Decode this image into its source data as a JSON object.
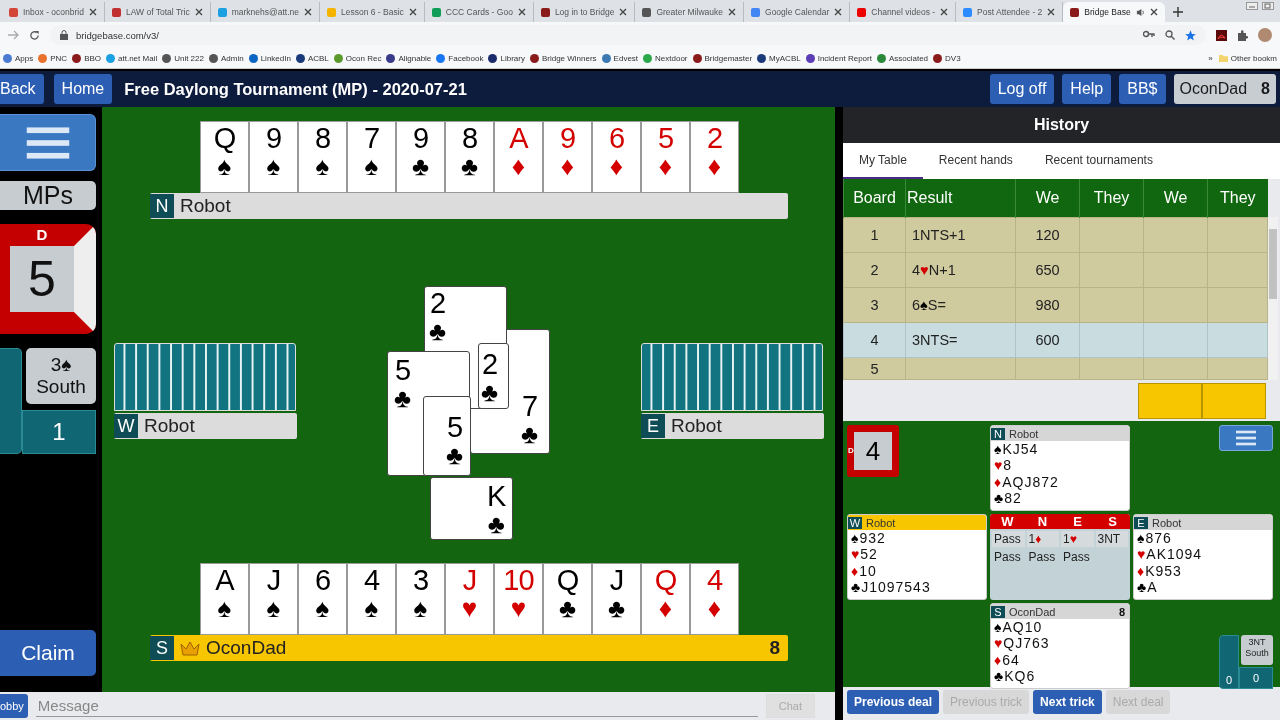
{
  "browser": {
    "tabs": [
      {
        "title": "Inbox - oconbrid",
        "color": "#d44638",
        "selected": false
      },
      {
        "title": "LAW of Total Tric",
        "color": "#c03030",
        "selected": false
      },
      {
        "title": "marknehs@att.ne",
        "color": "#1ba1e2",
        "selected": false
      },
      {
        "title": "Lesson 6 - Basic",
        "color": "#f4b400",
        "selected": false
      },
      {
        "title": "CCC Cards - Goo",
        "color": "#0f9d58",
        "selected": false
      },
      {
        "title": "Log in to Bridge",
        "color": "#8b1a1a",
        "selected": false
      },
      {
        "title": "Greater Milwauke",
        "color": "#555555",
        "selected": false
      },
      {
        "title": "Google Calendar",
        "color": "#4285f4",
        "selected": false
      },
      {
        "title": "Channel videos -",
        "color": "#ee0000",
        "selected": false
      },
      {
        "title": "Post Attendee - 2",
        "color": "#2d8cff",
        "selected": false
      },
      {
        "title": "Bridge Base",
        "color": "#8b1a1a",
        "selected": true
      }
    ],
    "url": "bridgebase.com/v3/",
    "bookmarks": [
      {
        "label": "Apps",
        "color": "#4a7bd0"
      },
      {
        "label": "PNC",
        "color": "#e8712b"
      },
      {
        "label": "BBO",
        "color": "#8b1a1a"
      },
      {
        "label": "att.net Mail",
        "color": "#1ba1e2"
      },
      {
        "label": "Unit 222",
        "color": "#555555"
      },
      {
        "label": "Admin",
        "color": "#555555"
      },
      {
        "label": "LinkedIn",
        "color": "#0a66c2"
      },
      {
        "label": "ACBL",
        "color": "#1a3a7a"
      },
      {
        "label": "Ocon Rec",
        "color": "#5a9a2a"
      },
      {
        "label": "Alignable",
        "color": "#3a3a8a"
      },
      {
        "label": "Facebook",
        "color": "#1877f2"
      },
      {
        "label": "Library",
        "color": "#1a2a6a"
      },
      {
        "label": "Bridge Winners",
        "color": "#8b1a1a"
      },
      {
        "label": "Edvest",
        "color": "#3a7ab0"
      },
      {
        "label": "Nextdoor",
        "color": "#2aa84a"
      },
      {
        "label": "Bridgemaster",
        "color": "#8b1a1a"
      },
      {
        "label": "MyACBL",
        "color": "#1a3a7a"
      },
      {
        "label": "Incident Report",
        "color": "#5b3db5"
      },
      {
        "label": "Associated",
        "color": "#2a8a3a"
      },
      {
        "label": "DV3",
        "color": "#8b1a1a"
      }
    ],
    "more": "»",
    "other": "Other bookm"
  },
  "app": {
    "nav": [
      "Back",
      "Home"
    ],
    "title": "Free Daylong Tournament (MP) - 2020-07-21",
    "actions": [
      "Log off",
      "Help",
      "BB$"
    ],
    "user": {
      "name": "OconDad",
      "badge": "8"
    }
  },
  "side": {
    "scoring": "MPs",
    "board": {
      "dealer": "D",
      "number": "5"
    },
    "contract": {
      "bid": "3",
      "suit": "♠",
      "declarer": "South"
    },
    "tricks": "1",
    "claim": "Claim"
  },
  "table": {
    "north": {
      "seat": "N",
      "name": "Robot",
      "active": false,
      "cards": [
        {
          "rank": "Q",
          "suit": "♠",
          "red": false
        },
        {
          "rank": "9",
          "suit": "♠",
          "red": false
        },
        {
          "rank": "8",
          "suit": "♠",
          "red": false
        },
        {
          "rank": "7",
          "suit": "♠",
          "red": false
        },
        {
          "rank": "9",
          "suit": "♣",
          "red": false
        },
        {
          "rank": "8",
          "suit": "♣",
          "red": false
        },
        {
          "rank": "A",
          "suit": "♦",
          "red": true
        },
        {
          "rank": "9",
          "suit": "♦",
          "red": true
        },
        {
          "rank": "6",
          "suit": "♦",
          "red": true
        },
        {
          "rank": "5",
          "suit": "♦",
          "red": true
        },
        {
          "rank": "2",
          "suit": "♦",
          "red": true
        }
      ]
    },
    "west": {
      "seat": "W",
      "name": "Robot",
      "active": false
    },
    "east": {
      "seat": "E",
      "name": "Robot",
      "active": false
    },
    "south": {
      "seat": "S",
      "name": "OconDad",
      "active": true,
      "badge": "8",
      "cards": [
        {
          "rank": "A",
          "suit": "♠",
          "red": false
        },
        {
          "rank": "J",
          "suit": "♠",
          "red": false
        },
        {
          "rank": "6",
          "suit": "♠",
          "red": false
        },
        {
          "rank": "4",
          "suit": "♠",
          "red": false
        },
        {
          "rank": "3",
          "suit": "♠",
          "red": false
        },
        {
          "rank": "J",
          "suit": "♥",
          "red": true
        },
        {
          "rank": "10",
          "suit": "♥",
          "red": true
        },
        {
          "rank": "Q",
          "suit": "♣",
          "red": false
        },
        {
          "rank": "J",
          "suit": "♣",
          "red": false
        },
        {
          "rank": "Q",
          "suit": "♦",
          "red": true
        },
        {
          "rank": "4",
          "suit": "♦",
          "red": true
        }
      ]
    },
    "trick": [
      {
        "rank": "7",
        "suit": "♣",
        "red": false
      },
      {
        "rank": "2",
        "suit": "♣",
        "red": false
      },
      {
        "rank": "2",
        "suit": "♣",
        "red": false
      },
      {
        "rank": "5",
        "suit": "♣",
        "red": false
      },
      {
        "rank": "5",
        "suit": "♣",
        "red": false
      },
      {
        "rank": "K",
        "suit": "♣",
        "red": false
      }
    ]
  },
  "chat": {
    "lobby": "obby",
    "placeholder": "Message",
    "send": "Chat"
  },
  "history": {
    "title": "History",
    "tabs": [
      {
        "label": "My Table",
        "selected": true
      },
      {
        "label": "Recent hands",
        "selected": false
      },
      {
        "label": "Recent tournaments",
        "selected": false
      }
    ],
    "columns": [
      "Board",
      "Result",
      "We",
      "They",
      "We",
      "They"
    ],
    "rows": [
      {
        "board": "1",
        "result": {
          "text": "1NTS+1"
        },
        "we": "120",
        "selected": false
      },
      {
        "board": "2",
        "result": {
          "text": "4",
          "suit": "♥",
          "red": true,
          "tail": "N+1"
        },
        "we": "650",
        "selected": false
      },
      {
        "board": "3",
        "result": {
          "text": "6",
          "suit": "♠",
          "red": false,
          "tail": "S="
        },
        "we": "980",
        "selected": false
      },
      {
        "board": "4",
        "result": {
          "text": "3NTS="
        },
        "we": "600",
        "selected": true
      },
      {
        "board": "5",
        "selected": false
      }
    ]
  },
  "deal": {
    "board": {
      "dealer": "D",
      "number": "4"
    },
    "hands": [
      {
        "seat": "N",
        "name": "Robot",
        "active": false,
        "suits": [
          {
            "suit": "♠",
            "red": false,
            "cards": "KJ54"
          },
          {
            "suit": "♥",
            "red": true,
            "cards": "8"
          },
          {
            "suit": "♦",
            "red": true,
            "cards": "AQJ872"
          },
          {
            "suit": "♣",
            "red": false,
            "cards": "82"
          }
        ]
      },
      {
        "seat": "W",
        "name": "Robot",
        "active": true,
        "suits": [
          {
            "suit": "♠",
            "red": false,
            "cards": "932"
          },
          {
            "suit": "♥",
            "red": true,
            "cards": "52"
          },
          {
            "suit": "♦",
            "red": true,
            "cards": "10"
          },
          {
            "suit": "♣",
            "red": false,
            "cards": "J1097543"
          }
        ]
      },
      {
        "seat": "E",
        "name": "Robot",
        "active": false,
        "suits": [
          {
            "suit": "♠",
            "red": false,
            "cards": "876"
          },
          {
            "suit": "♥",
            "red": true,
            "cards": "AK1094"
          },
          {
            "suit": "♦",
            "red": true,
            "cards": "K953"
          },
          {
            "suit": "♣",
            "red": false,
            "cards": "A"
          }
        ]
      },
      {
        "seat": "S",
        "name": "OconDad",
        "active": false,
        "badge": "8",
        "suits": [
          {
            "suit": "♠",
            "red": false,
            "cards": "AQ10"
          },
          {
            "suit": "♥",
            "red": true,
            "cards": "QJ763"
          },
          {
            "suit": "♦",
            "red": true,
            "cards": "64"
          },
          {
            "suit": "♣",
            "red": false,
            "cards": "KQ6"
          }
        ]
      }
    ],
    "auction": {
      "seats": [
        "W",
        "N",
        "E",
        "S"
      ],
      "calls": [
        {
          "text": "Pass"
        },
        {
          "text": "1",
          "suit": "♦",
          "red": true
        },
        {
          "text": "1",
          "suit": "♥",
          "red": true
        },
        {
          "text": "3NT"
        },
        {
          "text": "Pass"
        },
        {
          "text": "Pass"
        },
        {
          "text": "Pass"
        }
      ]
    },
    "score": {
      "contract": "3NT",
      "declarer": "South",
      "ns": "0",
      "ew": "0"
    }
  },
  "footer_buttons": [
    {
      "label": "Previous deal",
      "disabled": false
    },
    {
      "label": "Previous trick",
      "disabled": true
    },
    {
      "label": "Next trick",
      "disabled": false
    },
    {
      "label": "Next deal",
      "disabled": true
    }
  ]
}
